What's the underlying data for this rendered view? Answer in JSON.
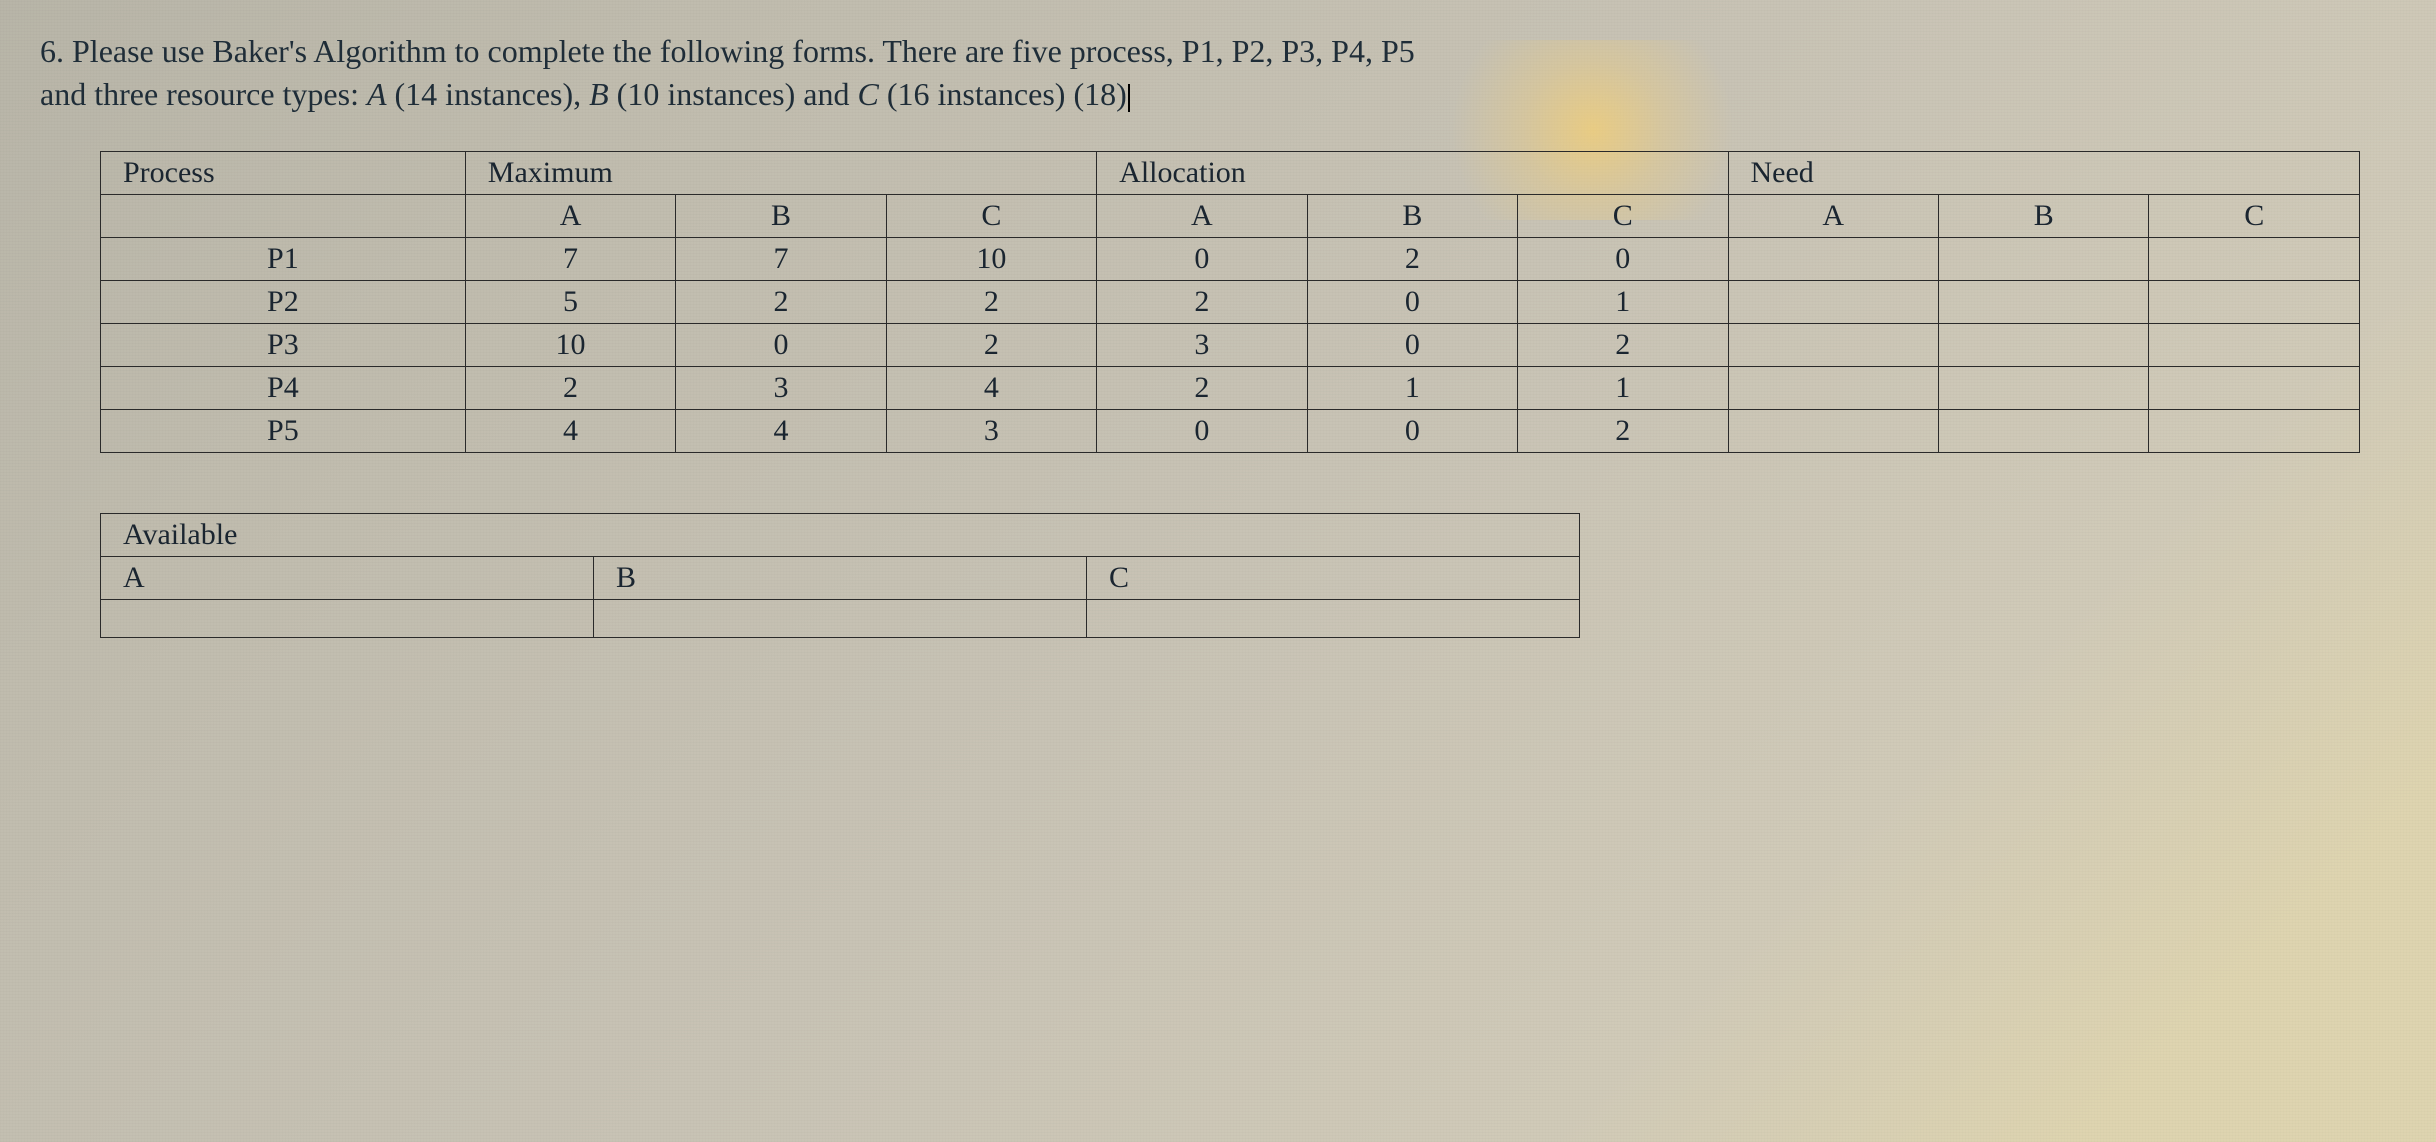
{
  "question": {
    "number": "6.",
    "text_part1": "Please use Baker's Algorithm to complete the following forms. There are five process, P1, P2, P3, P4, P5",
    "text_part2_prefix": "and three resource types: ",
    "resA_label": "A",
    "resA_count": "(14 instances), ",
    "resB_label": "B",
    "resB_count": "(10 instances) and ",
    "resC_label": "C",
    "resC_count": "(16 instances) ",
    "points": "(18)"
  },
  "headers": {
    "process": "Process",
    "maximum": "Maximum",
    "allocation": "Allocation",
    "need": "Need",
    "available": "Available",
    "A": "A",
    "B": "B",
    "C": "C"
  },
  "rows": [
    {
      "proc": "P1",
      "max": {
        "A": "7",
        "B": "7",
        "C": "10"
      },
      "alloc": {
        "A": "0",
        "B": "2",
        "C": "0"
      },
      "need": {
        "A": "",
        "B": "",
        "C": ""
      }
    },
    {
      "proc": "P2",
      "max": {
        "A": "5",
        "B": "2",
        "C": "2"
      },
      "alloc": {
        "A": "2",
        "B": "0",
        "C": "1"
      },
      "need": {
        "A": "",
        "B": "",
        "C": ""
      }
    },
    {
      "proc": "P3",
      "max": {
        "A": "10",
        "B": "0",
        "C": "2"
      },
      "alloc": {
        "A": "3",
        "B": "0",
        "C": "2"
      },
      "need": {
        "A": "",
        "B": "",
        "C": ""
      }
    },
    {
      "proc": "P4",
      "max": {
        "A": "2",
        "B": "3",
        "C": "4"
      },
      "alloc": {
        "A": "2",
        "B": "1",
        "C": "1"
      },
      "need": {
        "A": "",
        "B": "",
        "C": ""
      }
    },
    {
      "proc": "P5",
      "max": {
        "A": "4",
        "B": "4",
        "C": "3"
      },
      "alloc": {
        "A": "0",
        "B": "0",
        "C": "2"
      },
      "need": {
        "A": "",
        "B": "",
        "C": ""
      }
    }
  ],
  "available": {
    "A": "",
    "B": "",
    "C": ""
  }
}
